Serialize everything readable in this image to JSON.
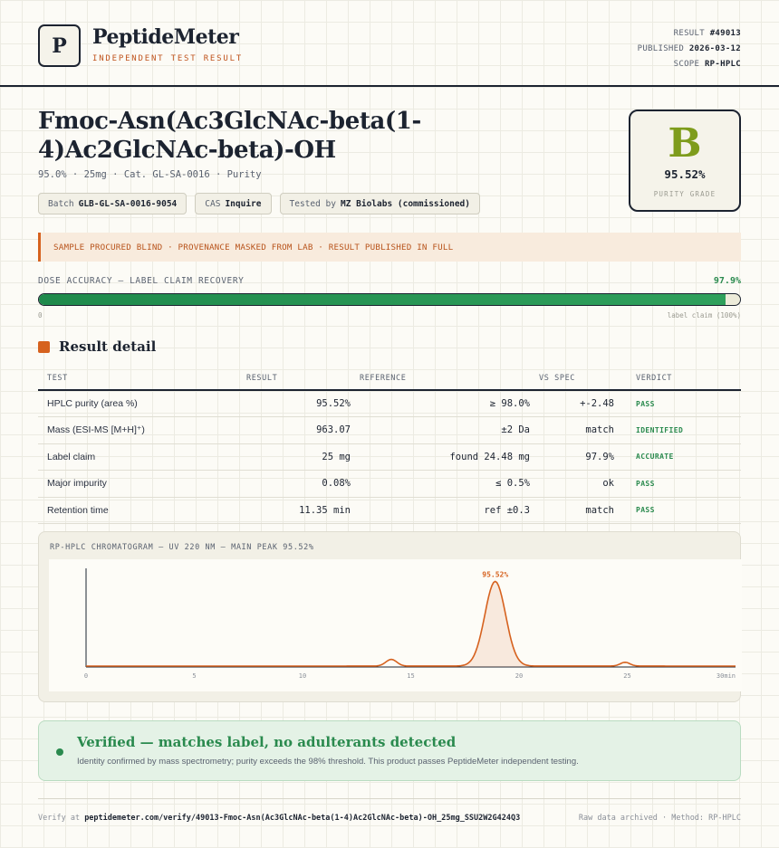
{
  "brand": {
    "logo_letter": "P",
    "name": "PeptideMeter",
    "tagline": "INDEPENDENT TEST RESULT"
  },
  "meta": {
    "result_label": "RESULT",
    "result_value": "#49013",
    "published_label": "PUBLISHED",
    "published_value": "2026-03-12",
    "scope_label": "SCOPE",
    "scope_value": "RP-HPLC"
  },
  "product": {
    "title": "Fmoc-Asn(Ac3GlcNAc-beta(1-4)Ac2GlcNAc-beta)-OH",
    "subline": "95.0% · 25mg · Cat. GL-SA-0016 · Purity"
  },
  "chips": [
    {
      "label": "Batch",
      "value": "GLB-GL-SA-0016-9054"
    },
    {
      "label": "CAS",
      "value": "Inquire"
    },
    {
      "label": "Tested by",
      "value": "MZ Biolabs (commissioned)"
    }
  ],
  "grade": {
    "letter": "B",
    "purity": "95.52%",
    "label": "PURITY GRADE"
  },
  "notice": "SAMPLE PROCURED BLIND · PROVENANCE MASKED FROM LAB · RESULT PUBLISHED IN FULL",
  "dose": {
    "label": "DOSE ACCURACY — LABEL CLAIM RECOVERY",
    "value_text": "97.9%",
    "fraction": 0.979,
    "min_label": "0",
    "max_label": "label claim (100%)"
  },
  "section_title": "Result detail",
  "table": {
    "headers": [
      "TEST",
      "RESULT",
      "REFERENCE",
      "VS SPEC",
      "VERDICT"
    ],
    "rows": [
      {
        "test": "HPLC purity (area %)",
        "result": "95.52%",
        "reference": "≥ 98.0%",
        "vs_spec": "+-2.48",
        "verdict": "PASS"
      },
      {
        "test": "Mass (ESI-MS [M+H]⁺)",
        "result": "963.07",
        "reference": "±2 Da",
        "vs_spec": "match",
        "verdict": "IDENTIFIED"
      },
      {
        "test": "Label claim",
        "result": "25 mg",
        "reference": "found 24.48 mg",
        "vs_spec": "97.9%",
        "verdict": "ACCURATE"
      },
      {
        "test": "Major impurity",
        "result": "0.08%",
        "reference": "≤ 0.5%",
        "vs_spec": "ok",
        "verdict": "PASS"
      },
      {
        "test": "Retention time",
        "result": "11.35 min",
        "reference": "ref ±0.3",
        "vs_spec": "match",
        "verdict": "PASS"
      }
    ]
  },
  "chart_data": {
    "type": "line",
    "title": "RP-HPLC CHROMATOGRAM — UV 220 NM — MAIN PEAK 95.52%",
    "xlabel": "",
    "ylabel": "",
    "xlim": [
      0,
      30
    ],
    "x_ticks": [
      "0",
      "5",
      "10",
      "15",
      "20",
      "25",
      "30"
    ],
    "x_unit_label": "min",
    "peak_label": "95.52%",
    "peaks": [
      {
        "rt": 14.1,
        "height": 0.07,
        "width": 0.25
      },
      {
        "rt": 18.9,
        "height": 0.89,
        "width": 0.48
      },
      {
        "rt": 24.9,
        "height": 0.04,
        "width": 0.22
      }
    ],
    "baseline": 0.01,
    "line_color": "#d6621f",
    "grid": false
  },
  "verified": {
    "title": "Verified — matches label, no adulterants detected",
    "description": "Identity confirmed by mass spectrometry; purity exceeds the 98% threshold. This product passes PeptideMeter independent testing."
  },
  "footer": {
    "verify_prefix": "Verify at",
    "verify_url": "peptidemeter.com/verify/49013-Fmoc-Asn(Ac3GlcNAc-beta(1-4)Ac2GlcNAc-beta)-OH_25mg_SSU2W2G424Q3",
    "right": "Raw data archived · Method: RP-HPLC"
  },
  "colors": {
    "accent": "#d6621f",
    "pass": "#2a8a4e",
    "grade": "#7e9c1c",
    "ink": "#1c2330"
  }
}
